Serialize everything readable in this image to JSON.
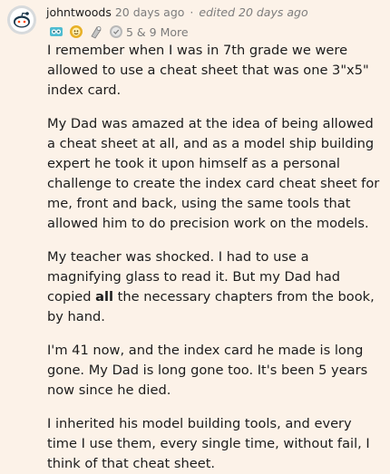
{
  "comment": {
    "username": "johntwoods",
    "time_posted": "20 days ago",
    "separator": "·",
    "edited": "edited 20 days ago",
    "awards": {
      "icons": [
        "silver-award-icon",
        "helpful-award-icon",
        "wholesome-award-icon",
        "gold-award-icon"
      ],
      "count_text": "5 & 9 More"
    },
    "paragraphs": {
      "p1": "I remember when I was in 7th grade we were allowed to use a cheat sheet that was one 3\"x5\" index card.",
      "p2": "My Dad was amazed at the idea of being allowed a cheat sheet at all, and as a model ship building expert he took it upon himself as a personal challenge to create the index card cheat sheet for me, front and back, using the same tools that allowed him to do precision work on the models.",
      "p3_before": "My teacher was shocked. I had to use a magnifying glass to read it. But my Dad had copied ",
      "p3_bold": "all",
      "p3_after": " the necessary chapters from the book, by hand.",
      "p4": "I'm 41 now, and the index card he made is long gone. My Dad is long gone too. It's been 5 years now since he died.",
      "p5": "I inherited his model building tools, and every time I use them, every single time, without fail, I think of that cheat sheet."
    }
  },
  "colors": {
    "background": "#fcf2e8",
    "text": "#1c1c1c",
    "meta": "#7c7c7c",
    "avatar_bg": "#d7dadc"
  }
}
